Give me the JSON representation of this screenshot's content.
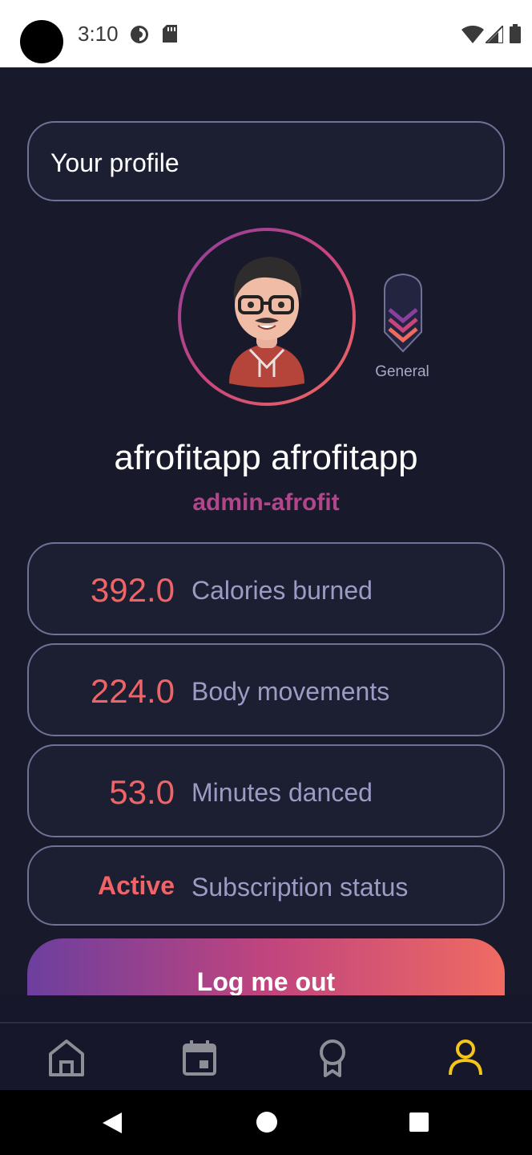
{
  "status_bar": {
    "time": "3:10",
    "icons": [
      "camera-cutout",
      "data-saver-icon",
      "sd-card-icon",
      "wifi-icon",
      "signal-icon",
      "battery-icon"
    ]
  },
  "header": {
    "title": "Your profile"
  },
  "profile": {
    "name": "afrofitapp afrofitapp",
    "handle": "admin-afrofit",
    "rank_label": "General"
  },
  "stats": [
    {
      "value": "392.0",
      "label": "Calories burned"
    },
    {
      "value": "224.0",
      "label": "Body movements"
    },
    {
      "value": "53.0",
      "label": "Minutes danced"
    },
    {
      "value": "Active",
      "label": "Subscription status"
    }
  ],
  "logout": {
    "label": "Log me out"
  },
  "bottom_nav": {
    "items": [
      {
        "icon": "home-icon",
        "active": false
      },
      {
        "icon": "calendar-icon",
        "active": false
      },
      {
        "icon": "award-icon",
        "active": false
      },
      {
        "icon": "profile-icon",
        "active": true
      }
    ]
  },
  "system_nav": [
    "back-icon",
    "home-circle-icon",
    "recents-icon"
  ],
  "colors": {
    "background": "#181a2b",
    "card_border": "#6f7195",
    "accent_value": "#ef6466",
    "label": "#9a9cc4",
    "handle": "#b2468a",
    "nav_active": "#f5c518",
    "nav_inactive": "#8e8f96"
  }
}
